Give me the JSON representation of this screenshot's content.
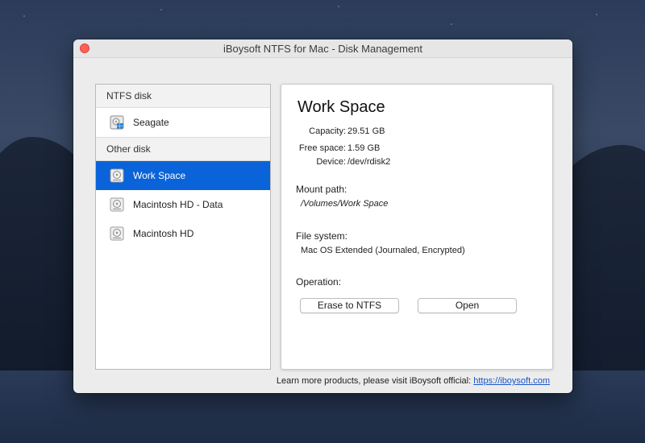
{
  "window": {
    "title": "iBoysoft NTFS for Mac - Disk Management"
  },
  "sidebar": {
    "groups": [
      {
        "label": "NTFS disk",
        "items": [
          {
            "label": "Seagate",
            "icon": "ntfs-disk-icon"
          }
        ]
      },
      {
        "label": "Other disk",
        "items": [
          {
            "label": "Work Space",
            "icon": "disk-icon",
            "selected": true
          },
          {
            "label": "Macintosh HD - Data",
            "icon": "disk-icon"
          },
          {
            "label": "Macintosh HD",
            "icon": "disk-icon"
          }
        ]
      }
    ]
  },
  "details": {
    "name": "Work Space",
    "capacity_label": "Capacity:",
    "capacity_value": "29.51 GB",
    "free_label": "Free space:",
    "free_value": "1.59 GB",
    "device_label": "Device:",
    "device_value": "/dev/rdisk2",
    "mount_label": "Mount path:",
    "mount_value": "/Volumes/Work Space",
    "fs_label": "File system:",
    "fs_value": "Mac OS Extended (Journaled, Encrypted)",
    "operation_label": "Operation:",
    "erase_button": "Erase to NTFS",
    "open_button": "Open"
  },
  "footer": {
    "text": "Learn more products, please visit iBoysoft official: ",
    "link": "https://iboysoft.com"
  },
  "colors": {
    "selection": "#0a63d8",
    "close_button": "#ff5f57",
    "link": "#1a55c9"
  }
}
